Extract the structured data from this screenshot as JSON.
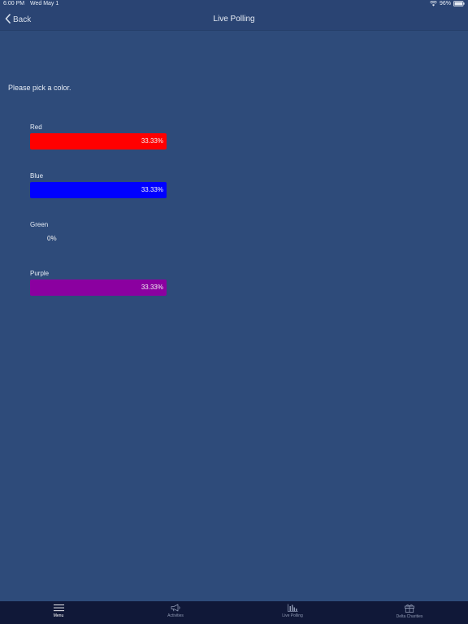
{
  "status_bar": {
    "time": "6:00 PM",
    "date": "Wed May 1",
    "battery": "96%"
  },
  "nav": {
    "back_label": "Back",
    "title": "Live Polling"
  },
  "poll": {
    "prompt": "Please pick a color.",
    "options": [
      {
        "label": "Red",
        "percent_text": "33.33%",
        "fraction": 0.3333,
        "color": "#ff0000"
      },
      {
        "label": "Blue",
        "percent_text": "33.33%",
        "fraction": 0.3333,
        "color": "#0000ff"
      },
      {
        "label": "Green",
        "percent_text": "0%",
        "fraction": 0,
        "color": "#00a000"
      },
      {
        "label": "Purple",
        "percent_text": "33.33%",
        "fraction": 0.3333,
        "color": "#8b00a0"
      }
    ]
  },
  "tabs": [
    {
      "label": "Menu",
      "icon": "menu-icon",
      "active": true
    },
    {
      "label": "Activities",
      "icon": "megaphone-icon",
      "active": false
    },
    {
      "label": "Live Polling",
      "icon": "bar-chart-icon",
      "active": false
    },
    {
      "label": "Delta Charities",
      "icon": "gift-icon",
      "active": false
    }
  ],
  "colors": {
    "background": "#2e4b7a",
    "nav_background": "#2a4473",
    "tab_bar_background": "#101838"
  }
}
